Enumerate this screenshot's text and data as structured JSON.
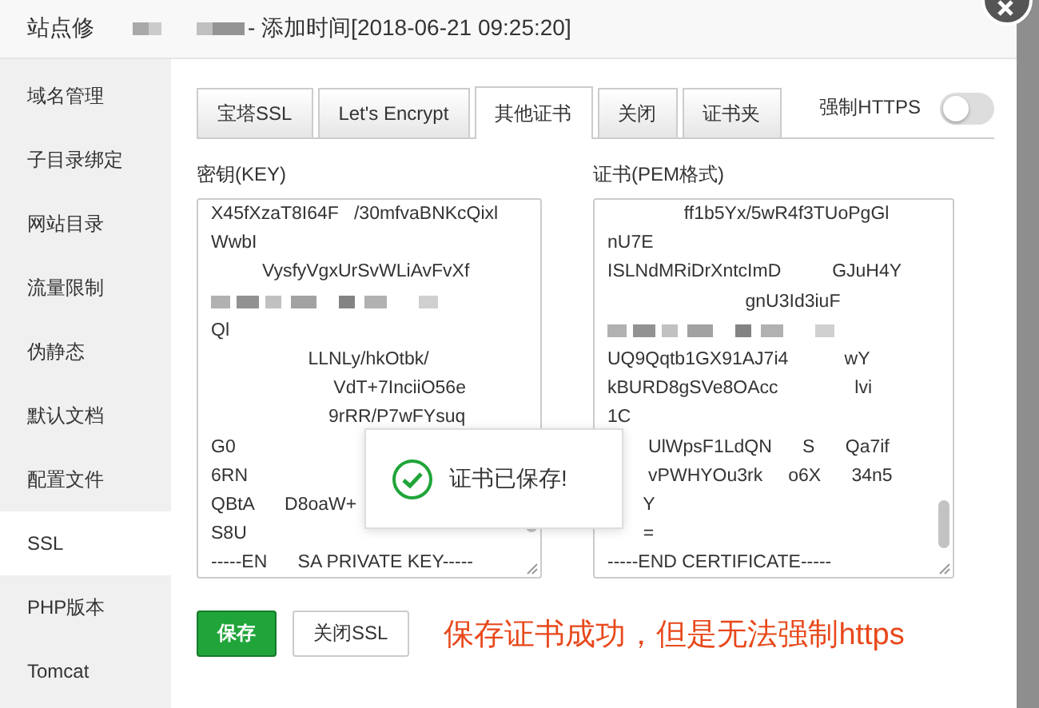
{
  "window": {
    "title_start": "站点修",
    "title_end": "- 添加时间[2018-06-21 09:25:20]"
  },
  "sidebar": {
    "items": [
      {
        "label": "域名管理",
        "selected": false
      },
      {
        "label": "子目录绑定",
        "selected": false
      },
      {
        "label": "网站目录",
        "selected": false
      },
      {
        "label": "流量限制",
        "selected": false
      },
      {
        "label": "伪静态",
        "selected": false
      },
      {
        "label": "默认文档",
        "selected": false
      },
      {
        "label": "配置文件",
        "selected": false
      },
      {
        "label": "SSL",
        "selected": true
      },
      {
        "label": "PHP版本",
        "selected": false
      },
      {
        "label": "Tomcat",
        "selected": false
      }
    ]
  },
  "tabs": [
    {
      "label": "宝塔SSL",
      "selected": false
    },
    {
      "label": "Let's Encrypt",
      "selected": false
    },
    {
      "label": "其他证书",
      "selected": true
    },
    {
      "label": "关闭",
      "selected": false
    },
    {
      "label": "证书夹",
      "selected": false
    }
  ],
  "force_https": {
    "label": "强制HTTPS",
    "on": false
  },
  "key_field": {
    "label": "密钥(KEY)",
    "lines": [
      {
        "kind": "text",
        "text": "X45fXzaT8I64F   /30mfvaBNKcQixl"
      },
      {
        "kind": "text",
        "text": "WwbI"
      },
      {
        "kind": "text",
        "text": "          VysfyVgxUrSvWLiAvFvXf"
      },
      {
        "kind": "blurred"
      },
      {
        "kind": "text",
        "text": "Ql"
      },
      {
        "kind": "text",
        "text": "                   LLNLy/hkOtbk/"
      },
      {
        "kind": "text",
        "text": "                        VdT+7InciiO56e"
      },
      {
        "kind": "text",
        "text": "                       9rRR/P7wFYsuq"
      },
      {
        "kind": "text",
        "text": "G0"
      },
      {
        "kind": "text",
        "text": "6RN"
      },
      {
        "kind": "text",
        "text": "QBtA      D8oaW+"
      },
      {
        "kind": "text",
        "text": "S8U"
      },
      {
        "kind": "text",
        "text": "-----EN      SA PRIVATE KEY-----"
      }
    ]
  },
  "cert_field": {
    "label": "证书(PEM格式)",
    "lines": [
      {
        "kind": "text",
        "text": "               ff1b5Yx/5wR4f3TUoPgGl"
      },
      {
        "kind": "text",
        "text": "nU7E"
      },
      {
        "kind": "text",
        "text": "ISLNdMRiDrXntcImD          GJuH4Y"
      },
      {
        "kind": "text",
        "text": "                           gnU3Id3iuF"
      },
      {
        "kind": "blurred"
      },
      {
        "kind": "text",
        "text": "UQ9Qqtb1GX91AJ7i4           wY"
      },
      {
        "kind": "text",
        "text": "kBURD8gSVe8OAcc               lvi"
      },
      {
        "kind": "text",
        "text": "1C"
      },
      {
        "kind": "text",
        "text": "        UlWpsF1LdQN      S      Qa7if"
      },
      {
        "kind": "text",
        "text": "        vPWHYOu3rk     o6X      34n5"
      },
      {
        "kind": "text",
        "text": "       Y"
      },
      {
        "kind": "text",
        "text": "       ="
      },
      {
        "kind": "text",
        "text": "-----END CERTIFICATE-----"
      }
    ]
  },
  "buttons": [
    {
      "label": "保存",
      "kind": "primary"
    },
    {
      "label": "关闭SSL",
      "kind": "default"
    }
  ],
  "toast": {
    "text": "证书已保存!"
  },
  "annotation": "保存证书成功，但是无法强制https"
}
